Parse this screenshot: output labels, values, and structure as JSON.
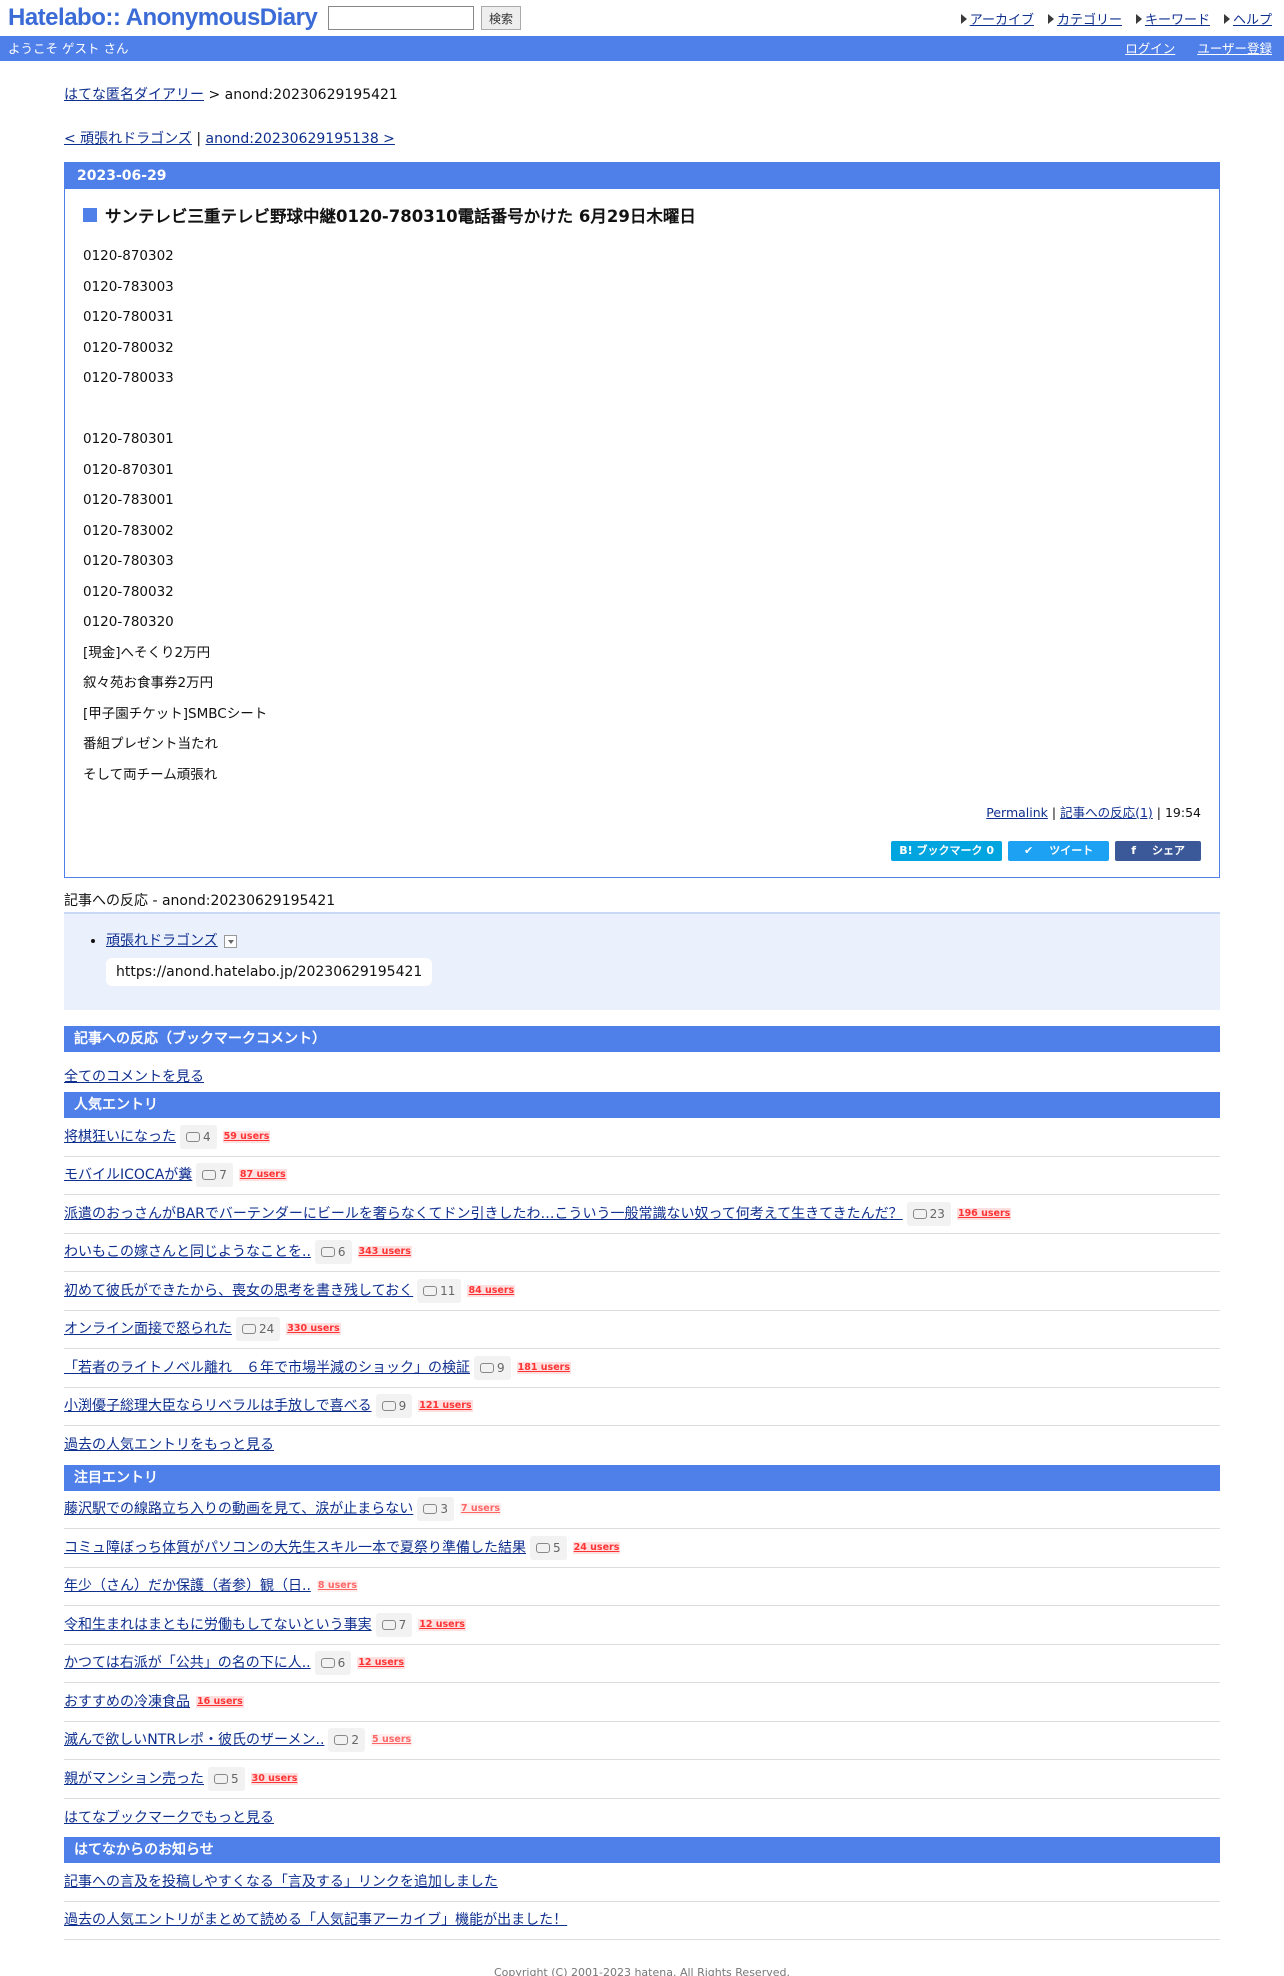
{
  "header": {
    "logo": "Hatelabo:: AnonymousDiary",
    "search_button": "検索",
    "nav": [
      "アーカイブ",
      "カテゴリー",
      "キーワード",
      "ヘルプ"
    ]
  },
  "userbar": {
    "welcome": "ようこそ ゲスト さん",
    "login": "ログイン",
    "register": "ユーザー登録"
  },
  "breadcrumb": {
    "home": "はてな匿名ダイアリー",
    "sep": " > ",
    "current": "anond:20230629195421"
  },
  "pager": {
    "prev": "< 頑張れドラゴンズ",
    "sep": " | ",
    "next": "anond:20230629195138 >"
  },
  "day": {
    "date": "2023-06-29",
    "title": "サンテレビ三重テレビ野球中継0120-780310電話番号かけた 6月29日木曜日",
    "lines": [
      "0120-870302",
      "0120-783003",
      "0120-780031",
      "0120-780032",
      "0120-780033",
      "",
      "0120-780301",
      "0120-870301",
      "0120-783001",
      "0120-783002",
      "0120-780303",
      "0120-780032",
      "0120-780320",
      "[現金]へそくり2万円",
      "叙々苑お食事券2万円",
      "[甲子園チケット]SMBCシート",
      "番組プレゼント当たれ",
      "そして両チーム頑張れ"
    ],
    "permalink": "Permalink",
    "sep": " | ",
    "reactions_link": "記事への反応(1)",
    "sep2": " | ",
    "time": "19:54",
    "share": {
      "bookmark": "B! ブックマーク 0",
      "tweet": "ツイート",
      "fb": "シェア"
    }
  },
  "refs": {
    "title": "記事への反応 - anond:20230629195421",
    "item_link": "頑張れドラゴンズ",
    "item_url": "https://anond.hatelabo.jp/20230629195421"
  },
  "bookmark_section": {
    "title": "記事への反応（ブックマークコメント）",
    "all_comments": "全てのコメントを見る"
  },
  "popular": {
    "title": "人気エントリ",
    "items": [
      {
        "title": "将棋狂いになった",
        "comments": "4",
        "users": "59 users"
      },
      {
        "title": "モバイルICOCAが糞",
        "comments": "7",
        "users": "87 users"
      },
      {
        "title": "派遣のおっさんがBARでバーテンダーにビールを奢らなくてドン引きしたわ…こういう一般常識ない奴って何考えて生きてきたんだ？",
        "comments": "23",
        "users": "196 users"
      },
      {
        "title": "わいもこの嫁さんと同じようなことを..",
        "comments": "6",
        "users": "343 users"
      },
      {
        "title": "初めて彼氏ができたから、喪女の思考を書き残しておく",
        "comments": "11",
        "users": "84 users"
      },
      {
        "title": "オンライン面接で怒られた",
        "comments": "24",
        "users": "330 users"
      },
      {
        "title": "「若者のライトノベル離れ　６年で市場半減のショック」の検証",
        "comments": "9",
        "users": "181 users"
      },
      {
        "title": "小渕優子総理大臣ならリベラルは手放しで喜べる",
        "comments": "9",
        "users": "121 users"
      }
    ],
    "more": "過去の人気エントリをもっと見る"
  },
  "hot": {
    "title": "注目エントリ",
    "items": [
      {
        "title": "藤沢駅での線路立ち入りの動画を見て、涙が止まらない",
        "comments": "3",
        "users": "7 users",
        "light": true
      },
      {
        "title": "コミュ障ぼっち体質がパソコンの大先生スキル一本で夏祭り準備した結果",
        "comments": "5",
        "users": "24 users",
        "light": false
      },
      {
        "title": "年少（さん）だか保護（者参）観（日..",
        "comments": "",
        "users": "8 users",
        "light": true
      },
      {
        "title": "令和生まれはまともに労働もしてないという事実",
        "comments": "7",
        "users": "12 users",
        "light": false
      },
      {
        "title": "かつては右派が「公共」の名の下に人..",
        "comments": "6",
        "users": "12 users",
        "light": false
      },
      {
        "title": "おすすめの冷凍食品",
        "comments": "",
        "users": "16 users",
        "light": false
      },
      {
        "title": "滅んで欲しいNTRレポ・彼氏のザーメン..",
        "comments": "2",
        "users": "5 users",
        "light": true
      },
      {
        "title": "親がマンション売った",
        "comments": "5",
        "users": "30 users",
        "light": false
      }
    ],
    "more": "はてなブックマークでもっと見る"
  },
  "news": {
    "title": "はてなからのお知らせ",
    "items": [
      "記事への言及を投稿しやすくなる「言及する」リンクを追加しました",
      "過去の人気エントリがまとめて読める「人気記事アーカイブ」機能が出ました！"
    ]
  },
  "footer": {
    "copyright": "Copyright (C) 2001-2023 hatena. All Rights Reserved."
  },
  "colors": {
    "accent": "#4f7fe8",
    "link": "#0f2f8f",
    "users": "#ff3333"
  }
}
